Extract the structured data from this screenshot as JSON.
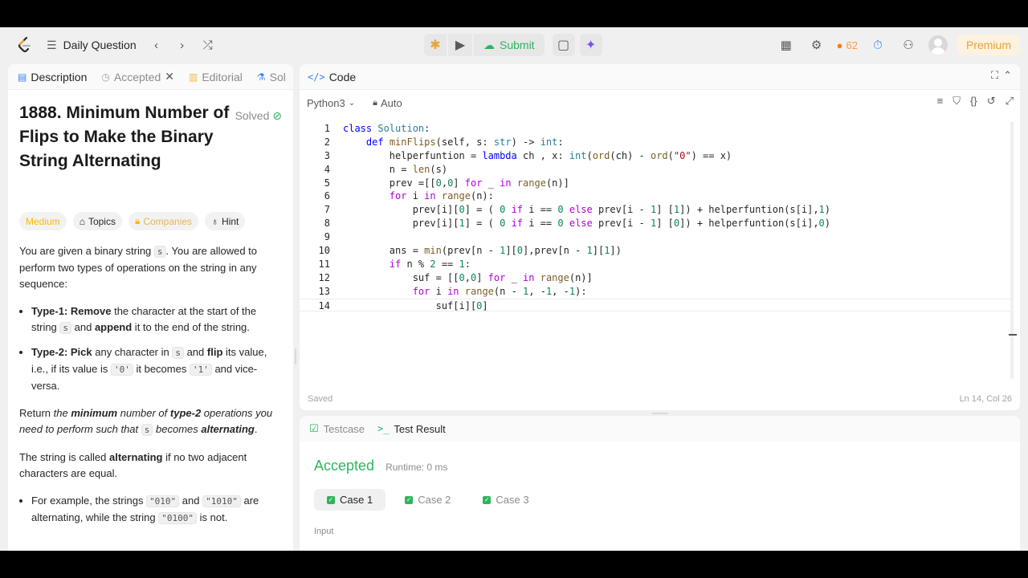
{
  "topnav": {
    "title": "Daily Question",
    "submit_label": "Submit",
    "streak": "62",
    "premium_label": "Premium"
  },
  "left_tabs": [
    {
      "label": "Description",
      "active": true
    },
    {
      "label": "Accepted"
    },
    {
      "label": "Editorial"
    },
    {
      "label": "Sol"
    }
  ],
  "problem": {
    "title": "1888. Minimum Number of Flips to Make the Binary String Alternating",
    "status": "Solved",
    "tags": {
      "difficulty": "Medium",
      "topics": "Topics",
      "companies": "Companies",
      "hint": "Hint"
    },
    "para1_a": "You are given a binary string ",
    "para1_code": "s",
    "para1_b": ". You are allowed to perform two types of operations on the string in any sequence:",
    "b1_strong": "Type-1: Remove",
    "b1_a": " the character at the start of the string ",
    "b1_code": "s",
    "b1_and": " and ",
    "b1_strong2": "append",
    "b1_b": " it to the end of the string.",
    "b2_strong": "Type-2: Pick",
    "b2_a": " any character in ",
    "b2_code": "s",
    "b2_and": " and ",
    "b2_strong2": "flip",
    "b2_b": " its value, i.e., if its value is ",
    "b2_code2": "'0'",
    "b2_c": " it becomes ",
    "b2_code3": "'1'",
    "b2_d": " and vice-versa.",
    "p2_a": "Return ",
    "p2_em1": "the ",
    "p2_strong1": "minimum",
    "p2_em2": " number of ",
    "p2_strong2": "type-2",
    "p2_em3": " operations you need to perform such that ",
    "p2_code": "s",
    "p2_em4": " becomes ",
    "p2_strong3": "alternating",
    "p2_end": ".",
    "p3_a": "The string is called ",
    "p3_strong": "alternating",
    "p3_b": " if no two adjacent characters are equal.",
    "ex_a": "For example, the strings ",
    "ex_code1": "\"010\"",
    "ex_and": " and ",
    "ex_code2": "\"1010\"",
    "ex_b": " are alternating, while the string ",
    "ex_code3": "\"0100\"",
    "ex_c": " is not."
  },
  "code_panel": {
    "header": "Code",
    "language": "Python3",
    "mode": "Auto",
    "saved": "Saved",
    "cursor_pos": "Ln 14, Col 26"
  },
  "result": {
    "tab_testcase": "Testcase",
    "tab_result": "Test Result",
    "status": "Accepted",
    "runtime": "Runtime: 0 ms",
    "cases": [
      "Case 1",
      "Case 2",
      "Case 3"
    ],
    "input_label": "Input"
  },
  "colors": {
    "accent_green": "#2db55d",
    "accent_orange": "#ffa116",
    "premium_bg": "#fdf1df"
  }
}
